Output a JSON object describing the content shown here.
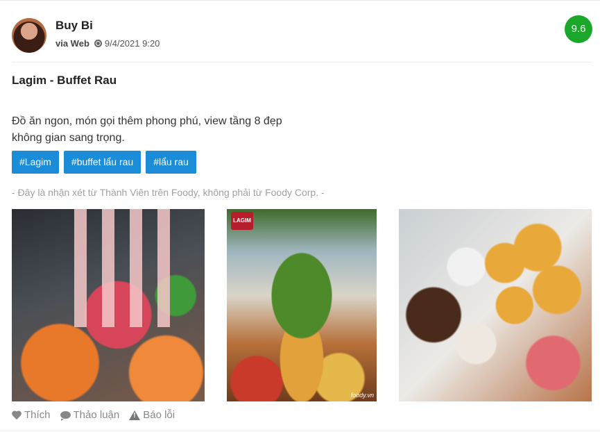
{
  "user": {
    "name": "Buy Bi",
    "via": "via Web",
    "datetime": "9/4/2021 9:20"
  },
  "score": "9.6",
  "score_color": "#1aa82b",
  "review": {
    "title": "Lagim - Buffet Rau",
    "body_line1": "Đồ ăn ngon, món gọi thêm phong phú, view tầng 8 đẹp",
    "body_line2": "không gian sang trọng."
  },
  "tags": [
    "#Lagim",
    "#buffet lẩu rau",
    "#lẩu rau"
  ],
  "tag_color": "#1a8cd8",
  "disclaimer": "- Đây là nhận xét từ Thành Viên trên Foody, không phải từ Foody Corp. -",
  "photos": [
    {
      "icon": "food-photo-hotpot"
    },
    {
      "icon": "food-photo-buffet",
      "logo_text": "LAGIM",
      "watermark": "foody.vn"
    },
    {
      "icon": "food-photo-dimsum"
    }
  ],
  "actions": {
    "like": "Thích",
    "discuss": "Thảo luận",
    "report": "Báo lỗi"
  }
}
